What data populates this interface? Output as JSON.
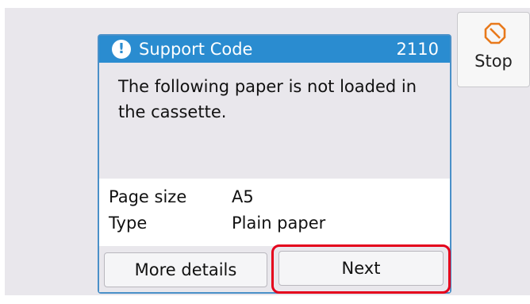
{
  "dialog": {
    "title": "Support Code",
    "code": "2110",
    "message": "The following paper is not loaded in the cassette.",
    "details": [
      {
        "label": "Page size",
        "value": "A5"
      },
      {
        "label": "Type",
        "value": "Plain paper"
      }
    ],
    "buttons": {
      "more_details": "More details",
      "next": "Next"
    }
  },
  "stop_button": {
    "label": "Stop"
  },
  "icons": {
    "alert": "exclamation-circle-icon",
    "stop": "stop-octagon-icon"
  },
  "colors": {
    "header": "#2a8cd0",
    "highlight": "#e4001c",
    "stop_icon": "#e8791b",
    "panel_background": "#e9e7ec"
  }
}
